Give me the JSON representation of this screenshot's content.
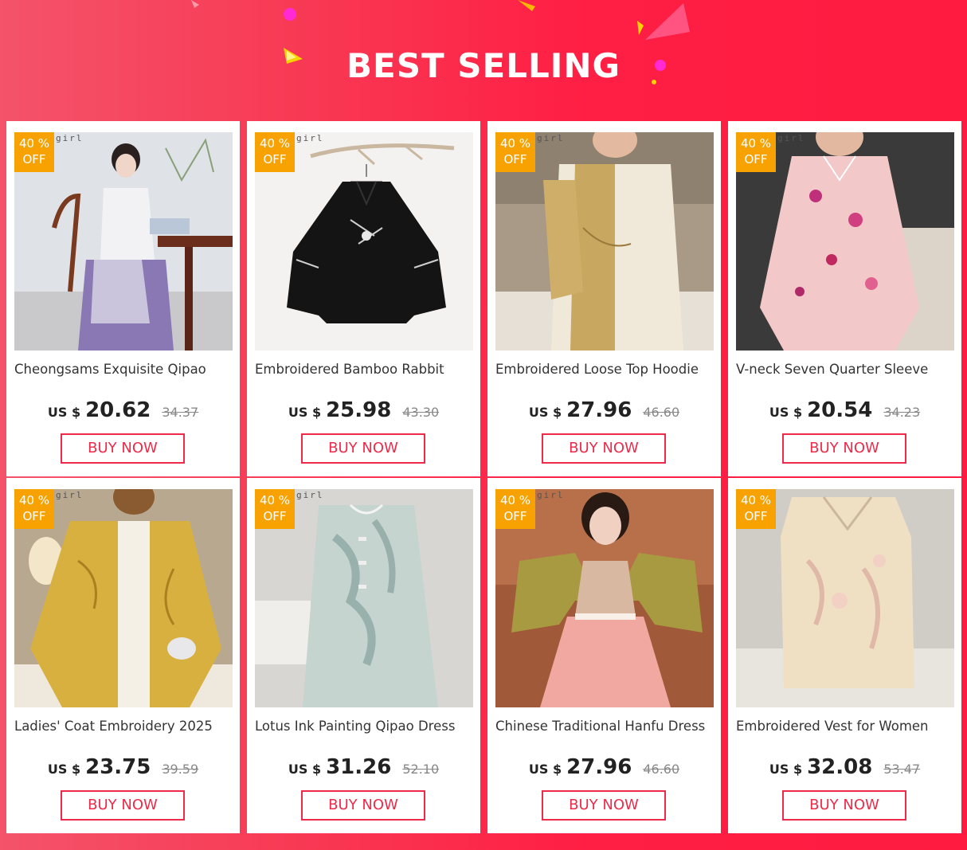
{
  "header": {
    "title": "BEST SELLING"
  },
  "colors": {
    "accent": "#ee2a4a",
    "badge": "#f7a200",
    "background": "#ff1f44"
  },
  "products": [
    {
      "name": "Cheongsams Exquisite Qipao",
      "currency": "US $",
      "price": "20.62",
      "old_price": "34.37",
      "badge_pct": "40  %",
      "badge_off": "OFF",
      "brand": "girl",
      "buy_label": "BUY NOW",
      "image": "woman-in-qipao-at-table"
    },
    {
      "name": "Embroidered Bamboo Rabbit",
      "currency": "US $",
      "price": "25.98",
      "old_price": "43.30",
      "badge_pct": "40  %",
      "badge_off": "OFF",
      "brand": "girl",
      "buy_label": "BUY NOW",
      "image": "black-embroidered-jacket-on-hanger"
    },
    {
      "name": "Embroidered Loose Top Hoodie",
      "currency": "US $",
      "price": "27.96",
      "old_price": "46.60",
      "badge_pct": "40  %",
      "badge_off": "OFF",
      "brand": "girl",
      "buy_label": "BUY NOW",
      "image": "gold-brocade-top"
    },
    {
      "name": "V-neck Seven Quarter Sleeve",
      "currency": "US $",
      "price": "20.54",
      "old_price": "34.23",
      "badge_pct": "40  %",
      "badge_off": "OFF",
      "brand": "girl",
      "buy_label": "BUY NOW",
      "image": "pink-floral-blouse"
    },
    {
      "name": "Ladies' Coat Embroidery 2025",
      "currency": "US $",
      "price": "23.75",
      "old_price": "39.59",
      "badge_pct": "40  %",
      "badge_off": "OFF",
      "brand": "girl",
      "buy_label": "BUY NOW",
      "image": "yellow-embroidered-coat"
    },
    {
      "name": "Lotus Ink Painting Qipao Dress",
      "currency": "US $",
      "price": "31.26",
      "old_price": "52.10",
      "badge_pct": "40  %",
      "badge_off": "OFF",
      "brand": "girl",
      "buy_label": "BUY NOW",
      "image": "ink-painting-qipao"
    },
    {
      "name": "Chinese Traditional Hanfu Dress",
      "currency": "US $",
      "price": "27.96",
      "old_price": "46.60",
      "badge_pct": "40  %",
      "badge_off": "OFF",
      "brand": "girl",
      "buy_label": "BUY NOW",
      "image": "hanfu-dress-girl"
    },
    {
      "name": "Embroidered Vest for Women",
      "currency": "US $",
      "price": "32.08",
      "old_price": "53.47",
      "badge_pct": "40  %",
      "badge_off": "OFF",
      "brand": "",
      "buy_label": "BUY NOW",
      "image": "embroidered-vest"
    }
  ]
}
